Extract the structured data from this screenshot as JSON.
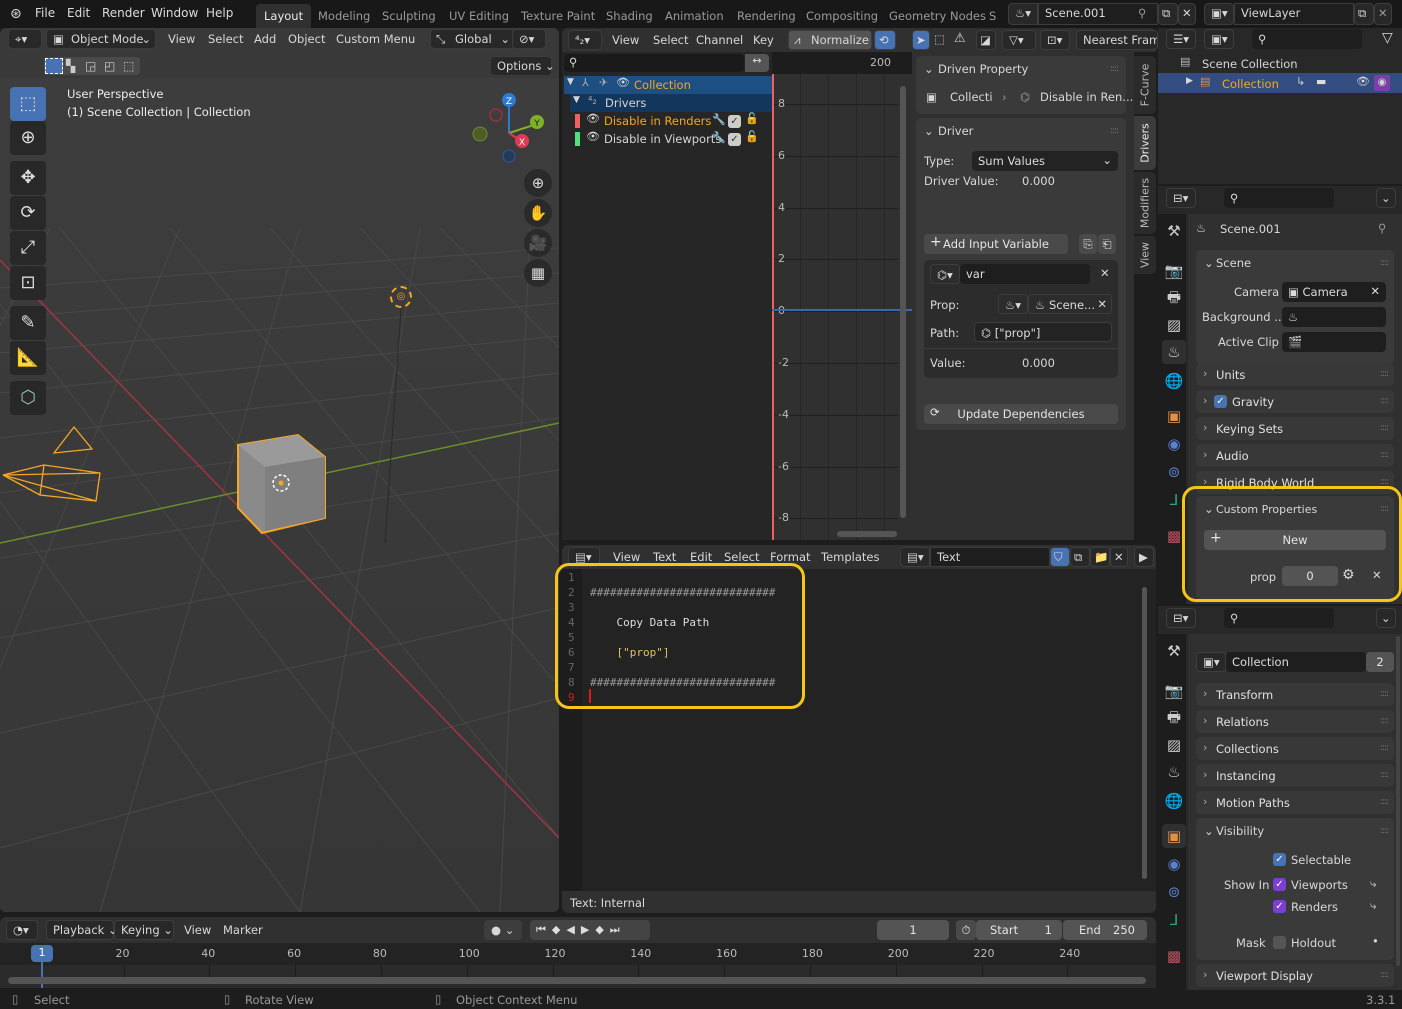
{
  "topbar": {
    "menus": [
      "File",
      "Edit",
      "Render",
      "Window",
      "Help"
    ],
    "workspaces": [
      "Layout",
      "Modeling",
      "Sculpting",
      "UV Editing",
      "Texture Paint",
      "Shading",
      "Animation",
      "Rendering",
      "Compositing",
      "Geometry Nodes",
      "S"
    ],
    "active_workspace": "Layout",
    "scene_name": "Scene.001",
    "view_layer": "ViewLayer"
  },
  "viewport": {
    "mode": "Object Mode",
    "menus": [
      "View",
      "Select",
      "Add",
      "Object",
      "Custom Menu"
    ],
    "transform_orientation": "Global",
    "options_label": "Options",
    "overlay_title": "User Perspective",
    "overlay_subtitle": "(1) Scene Collection | Collection",
    "gizmo_axes": {
      "x": "X",
      "y": "Y",
      "z": "Z"
    },
    "tools": [
      "select-box",
      "cursor",
      "move",
      "rotate",
      "scale",
      "transform",
      "annotate",
      "measure",
      "add-cube"
    ],
    "nav_buttons": [
      "zoom",
      "pan",
      "camera",
      "perspective"
    ]
  },
  "drivers_editor": {
    "menus": [
      "View",
      "Select",
      "Channel",
      "Key"
    ],
    "normalize_label": "Normalize",
    "snap_mode": "Nearest Frame",
    "frame_label": "200",
    "channels": [
      {
        "name": "Collection",
        "level": 0,
        "highlight": true
      },
      {
        "name": "Drivers",
        "level": 1
      },
      {
        "name": "Disable in Renders",
        "level": 2,
        "color": "#f06060",
        "active": true
      },
      {
        "name": "Disable in Viewports",
        "level": 2,
        "color": "#50e080"
      }
    ],
    "y_ticks": [
      "8",
      "6",
      "4",
      "2",
      "0",
      "-2",
      "-4",
      "-6",
      "-8"
    ],
    "side_tabs": [
      "F-Curve",
      "Drivers",
      "Modifiers",
      "View"
    ],
    "active_side_tab": "Drivers",
    "driven_property": {
      "title": "Driven Property",
      "object": "Collecti",
      "property": "Disable in Ren..."
    },
    "driver": {
      "title": "Driver",
      "type_label": "Type:",
      "type_value": "Sum Values",
      "driver_value_label": "Driver Value:",
      "driver_value": "0.000",
      "add_variable_label": "Add Input Variable",
      "variable": {
        "name": "var",
        "prop_label": "Prop:",
        "prop_value": "Scene...",
        "path_label": "Path:",
        "path_value": "[\"prop\"]",
        "value_label": "Value:",
        "value": "0.000"
      },
      "update_label": "Update Dependencies"
    }
  },
  "text_editor": {
    "menus": [
      "View",
      "Text",
      "Edit",
      "Select",
      "Format",
      "Templates"
    ],
    "text_name": "Text",
    "lines": [
      {
        "n": "1",
        "text": ""
      },
      {
        "n": "2",
        "text": "############################"
      },
      {
        "n": "3",
        "text": ""
      },
      {
        "n": "4",
        "text": "    Copy Data Path"
      },
      {
        "n": "5",
        "text": ""
      },
      {
        "n": "6",
        "text": "    [\"prop\"]"
      },
      {
        "n": "7",
        "text": ""
      },
      {
        "n": "8",
        "text": "############################"
      },
      {
        "n": "9",
        "text": ""
      }
    ],
    "status": "Text: Internal"
  },
  "outliner": {
    "items": [
      {
        "name": "Scene Collection"
      },
      {
        "name": "Collection",
        "selected": true
      }
    ]
  },
  "scene_properties": {
    "datablock": "Scene.001",
    "scene_panel": {
      "title": "Scene",
      "camera_label": "Camera",
      "camera_value": "Camera",
      "background_label": "Background ...",
      "active_clip_label": "Active Clip"
    },
    "collapsed_panels": [
      "Units",
      "Gravity",
      "Keying Sets",
      "Audio",
      "Rigid Body World"
    ],
    "gravity_checked": true,
    "custom_properties": {
      "title": "Custom Properties",
      "new_label": "New",
      "prop_name": "prop",
      "prop_value": "0"
    }
  },
  "object_properties": {
    "datablock": "Collection",
    "users": "2",
    "collapsed_panels": [
      "Transform",
      "Relations",
      "Collections",
      "Instancing",
      "Motion Paths"
    ],
    "visibility": {
      "title": "Visibility",
      "selectable_label": "Selectable",
      "show_in_label": "Show In",
      "viewports_label": "Viewports",
      "renders_label": "Renders",
      "mask_label": "Mask",
      "holdout_label": "Holdout"
    },
    "viewport_display": "Viewport Display"
  },
  "timeline": {
    "menus": [
      "Playback",
      "Keying",
      "View",
      "Marker"
    ],
    "current_frame": "1",
    "start_label": "Start",
    "start": "1",
    "end_label": "End",
    "end": "250",
    "ticks": [
      "20",
      "40",
      "60",
      "80",
      "100",
      "120",
      "140",
      "160",
      "180",
      "200",
      "220",
      "240"
    ]
  },
  "statusbar": {
    "hints": [
      "Select",
      "Rotate View",
      "Object Context Menu"
    ],
    "version": "3.3.1"
  },
  "colors": {
    "accent": "#4772b3",
    "selection": "#f5a623",
    "highlight_box": "#f5c518"
  }
}
